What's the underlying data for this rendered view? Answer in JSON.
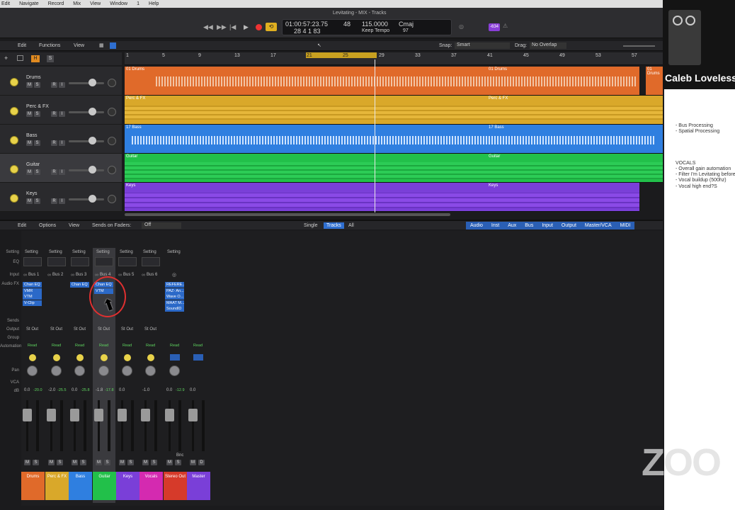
{
  "menubar": {
    "items": [
      "Edit",
      "Navigate",
      "Record",
      "Mix",
      "View",
      "Window",
      "1",
      "Help"
    ]
  },
  "window_title": "Levitating - MIX - Tracks",
  "lcd": {
    "time": "01:00:57:23.75",
    "bars": "28  4  1    83",
    "frame": "48",
    "tempo": "115.0000",
    "tempo_label": "Keep Tempo",
    "key": "Cmaj",
    "bottom": "97"
  },
  "count_badge": "-634",
  "toolbar": {
    "edit": "Edit",
    "functions": "Functions",
    "view": "View",
    "snap_label": "Snap:",
    "snap_value": "Smart",
    "drag_label": "Drag:",
    "drag_value": "No Overlap"
  },
  "ruler": [
    "1",
    "5",
    "9",
    "13",
    "17",
    "21",
    "25",
    "29",
    "33",
    "37",
    "41",
    "45",
    "49",
    "53",
    "57"
  ],
  "tracks": [
    {
      "name": "Drums",
      "region": "01 Drums",
      "region2": "01 Drums",
      "region3": "01 Drums",
      "color": "#e06a2a"
    },
    {
      "name": "Perc & FX",
      "region": "Perc & FX",
      "region2": "Perc & FX",
      "color": "#d9a82a"
    },
    {
      "name": "Bass",
      "region": "17 Bass",
      "region2": "17 Bass",
      "color": "#2f7fe0"
    },
    {
      "name": "Guitar",
      "region": "Guitar",
      "region2": "Guitar",
      "color": "#22c04a"
    },
    {
      "name": "Keys",
      "region": "Keys",
      "region2": "Keys",
      "color": "#7a3fd8"
    }
  ],
  "track_buttons": {
    "m": "M",
    "s": "S",
    "r": "R",
    "i": "I"
  },
  "mixer_toolbar": {
    "edit": "Edit",
    "options": "Options",
    "view": "View",
    "sends_label": "Sends on Faders:",
    "sends_value": "Off",
    "single": "Single",
    "tracks": "Tracks",
    "all": "All",
    "filters": [
      "Audio",
      "Inst",
      "Aux",
      "Bus",
      "Input",
      "Output",
      "Master/VCA",
      "MIDI"
    ]
  },
  "row_labels": {
    "setting": "Setting",
    "eq": "EQ",
    "input": "Input",
    "audiofx": "Audio FX",
    "sends": "Sends",
    "output": "Output",
    "group": "Group",
    "automation": "Automation",
    "pan": "Pan",
    "vca": "VCA",
    "db": "dB"
  },
  "channels": [
    {
      "label": "Drums",
      "setting": "Setting",
      "input": "Bus 1",
      "plugins": [
        "Chan EQ",
        "VMR",
        "VTM",
        "V-Clip"
      ],
      "output": "St Out",
      "auto": "Read",
      "db1": "0.0",
      "db2": "-20.0",
      "color": "#e06a2a",
      "mode": "normal"
    },
    {
      "label": "Perc & FX",
      "setting": "Setting",
      "input": "Bus 2",
      "plugins": [],
      "output": "St Out",
      "auto": "Read",
      "db1": "-2.0",
      "db2": "-25.5",
      "color": "#d9a82a",
      "mode": "normal"
    },
    {
      "label": "Bass",
      "setting": "Setting",
      "input": "Bus 3",
      "plugins": [
        "Chan EQ"
      ],
      "output": "St Out",
      "auto": "Read",
      "db1": "0.0",
      "db2": "-25.8",
      "color": "#2f7fe0",
      "mode": "normal"
    },
    {
      "label": "Guitar",
      "setting": "Setting",
      "input": "Bus 4",
      "plugins": [
        "Chan EQ",
        "VTM"
      ],
      "output": "St Out",
      "auto": "Read",
      "db1": "-1.8",
      "db2": "-17.8",
      "color": "#22c04a",
      "mode": "selected"
    },
    {
      "label": "Keys",
      "setting": "Setting",
      "input": "Bus 5",
      "plugins": [],
      "output": "St Out",
      "auto": "Read",
      "db1": "0.0",
      "db2": "",
      "color": "#7a3fd8",
      "mode": "normal"
    },
    {
      "label": "Vocals",
      "setting": "Setting",
      "input": "Bus 6",
      "plugins": [],
      "output": "St Out",
      "auto": "Read",
      "db1": "-1.0",
      "db2": "",
      "color": "#d42ab0",
      "mode": "normal"
    },
    {
      "label": "Stereo Out",
      "setting": "Setting",
      "input": "",
      "plugins": [
        "REFERE...",
        "PAZ- An...",
        "Wave O...",
        "MAAT M...",
        "SoundID"
      ],
      "output": "",
      "auto": "Read",
      "db1": "0.0",
      "db2": "-12.9",
      "color": "#d63a2a",
      "mode": "stereo"
    },
    {
      "label": "Master",
      "setting": "",
      "input": "",
      "plugins": [],
      "output": "",
      "auto": "Read",
      "db1": "0.0",
      "db2": "",
      "color": "#7a3fd8",
      "mode": "master"
    }
  ],
  "bnc": "Bnc",
  "presenter_name": "Caleb Loveless",
  "notes": [
    "- Bus Processing",
    "- Spatial Processing",
    "",
    "VOCALS",
    "- Overall gain automation",
    "- Filter I'm Levitating before",
    "- Vocal buildup (500hz)",
    "- Vocal high end?S"
  ],
  "zoom_watermark": "ZOO"
}
